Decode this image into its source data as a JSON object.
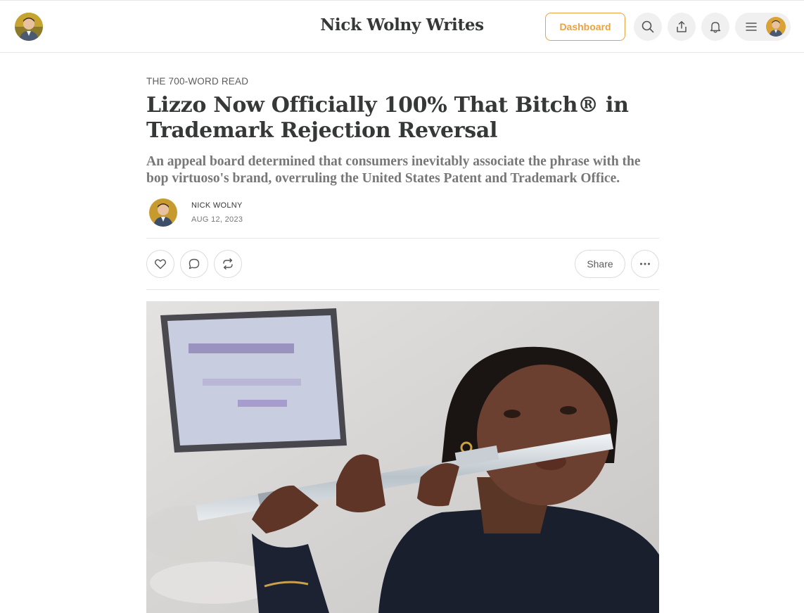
{
  "header": {
    "site_title": "Nick Wolny Writes",
    "dashboard_label": "Dashboard",
    "icons": [
      "search-icon",
      "share-icon",
      "bell-icon",
      "menu-icon"
    ]
  },
  "article": {
    "eyebrow": "THE 700-WORD READ",
    "title": "Lizzo Now Officially 100% That Bitch® in Trademark Rejection Reversal",
    "subtitle": "An appeal board determined that consumers inevitably associate the phrase with the bop virtuoso's brand, overruling the United States Patent and Trademark Office.",
    "author": "NICK WOLNY",
    "date": "AUG 12, 2023"
  },
  "actions": {
    "share_label": "Share",
    "icons": [
      "heart-icon",
      "comment-icon",
      "restack-icon",
      "more-icon"
    ]
  },
  "colors": {
    "accent": "#e8a243",
    "text": "#363737",
    "muted": "#777777",
    "border": "#e6e6e6"
  }
}
